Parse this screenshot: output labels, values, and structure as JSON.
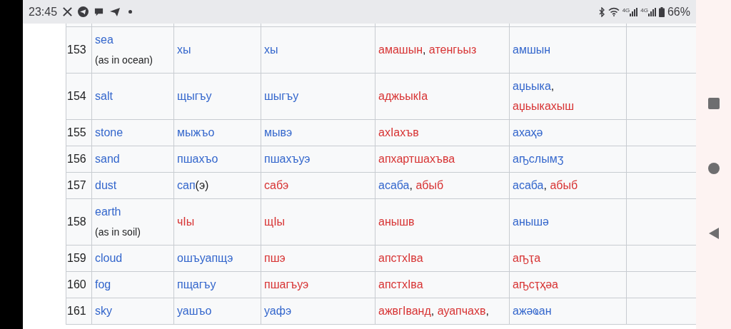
{
  "status_bar": {
    "time": "23:45",
    "network_labels": [
      "4G",
      "4G"
    ],
    "battery": "66%"
  },
  "table": {
    "rows": [
      {
        "number": "153",
        "cells": [
          [
            [
              {
                "kind": "link",
                "text": "sea"
              }
            ],
            [
              {
                "kind": "note",
                "text": "(as in ocean)"
              }
            ]
          ],
          [
            [
              {
                "kind": "link",
                "text": "хы"
              }
            ]
          ],
          [
            [
              {
                "kind": "link",
                "text": "хы"
              }
            ]
          ],
          [
            [
              {
                "kind": "redlink",
                "text": "амашын"
              },
              {
                "kind": "plain",
                "text": ", "
              },
              {
                "kind": "redlink",
                "text": "атенгьыз"
              }
            ]
          ],
          [
            [
              {
                "kind": "link",
                "text": "амшын"
              }
            ]
          ]
        ]
      },
      {
        "number": "154",
        "cells": [
          [
            [
              {
                "kind": "link",
                "text": "salt"
              }
            ]
          ],
          [
            [
              {
                "kind": "link",
                "text": "щыгъу"
              }
            ]
          ],
          [
            [
              {
                "kind": "link",
                "text": "шыгъу"
              }
            ]
          ],
          [
            [
              {
                "kind": "redlink",
                "text": "аджьыкIа"
              }
            ]
          ],
          [
            [
              {
                "kind": "link",
                "text": "аџьыка"
              },
              {
                "kind": "plain",
                "text": ","
              }
            ],
            [
              {
                "kind": "redlink",
                "text": "аџьыкахыш"
              }
            ]
          ]
        ]
      },
      {
        "number": "155",
        "cells": [
          [
            [
              {
                "kind": "link",
                "text": "stone"
              }
            ]
          ],
          [
            [
              {
                "kind": "link",
                "text": "мыжъо"
              }
            ]
          ],
          [
            [
              {
                "kind": "link",
                "text": "мывэ"
              }
            ]
          ],
          [
            [
              {
                "kind": "redlink",
                "text": "ахIахъв"
              }
            ]
          ],
          [
            [
              {
                "kind": "link",
                "text": "ахаҳә"
              }
            ]
          ]
        ]
      },
      {
        "number": "156",
        "cells": [
          [
            [
              {
                "kind": "link",
                "text": "sand"
              }
            ]
          ],
          [
            [
              {
                "kind": "link",
                "text": "пшахъо"
              }
            ]
          ],
          [
            [
              {
                "kind": "link",
                "text": "пшахъуэ"
              }
            ]
          ],
          [
            [
              {
                "kind": "redlink",
                "text": "апхартшахъва"
              }
            ]
          ],
          [
            [
              {
                "kind": "link",
                "text": "аҧслымӡ"
              }
            ]
          ]
        ]
      },
      {
        "number": "157",
        "cells": [
          [
            [
              {
                "kind": "link",
                "text": "dust"
              }
            ]
          ],
          [
            [
              {
                "kind": "link",
                "text": "сап"
              },
              {
                "kind": "plain",
                "text": "(э)"
              }
            ]
          ],
          [
            [
              {
                "kind": "redlink",
                "text": "сабэ"
              }
            ]
          ],
          [
            [
              {
                "kind": "link",
                "text": "асаба"
              },
              {
                "kind": "plain",
                "text": ", "
              },
              {
                "kind": "redlink",
                "text": "абыб"
              }
            ]
          ],
          [
            [
              {
                "kind": "link",
                "text": "асаба"
              },
              {
                "kind": "plain",
                "text": ", "
              },
              {
                "kind": "redlink",
                "text": "абыб"
              }
            ]
          ]
        ]
      },
      {
        "number": "158",
        "cells": [
          [
            [
              {
                "kind": "link",
                "text": "earth"
              }
            ],
            [
              {
                "kind": "note",
                "text": "(as in soil)"
              }
            ]
          ],
          [
            [
              {
                "kind": "redlink",
                "text": "чIы"
              }
            ]
          ],
          [
            [
              {
                "kind": "redlink",
                "text": "щIы"
              }
            ]
          ],
          [
            [
              {
                "kind": "redlink",
                "text": "анышв"
              }
            ]
          ],
          [
            [
              {
                "kind": "link",
                "text": "анышә"
              }
            ]
          ]
        ]
      },
      {
        "number": "159",
        "cells": [
          [
            [
              {
                "kind": "link",
                "text": "cloud"
              }
            ]
          ],
          [
            [
              {
                "kind": "link",
                "text": "ошъуапщэ"
              }
            ]
          ],
          [
            [
              {
                "kind": "redlink",
                "text": "пшэ"
              }
            ]
          ],
          [
            [
              {
                "kind": "redlink",
                "text": "апстхIва"
              }
            ]
          ],
          [
            [
              {
                "kind": "redlink",
                "text": "аҧҭа"
              }
            ]
          ]
        ]
      },
      {
        "number": "160",
        "cells": [
          [
            [
              {
                "kind": "link",
                "text": "fog"
              }
            ]
          ],
          [
            [
              {
                "kind": "link",
                "text": "пщагъу"
              }
            ]
          ],
          [
            [
              {
                "kind": "redlink",
                "text": "пшагъуэ"
              }
            ]
          ],
          [
            [
              {
                "kind": "redlink",
                "text": "апстхIва"
              }
            ]
          ],
          [
            [
              {
                "kind": "redlink",
                "text": "аҧсҭҳәа"
              }
            ]
          ]
        ]
      },
      {
        "number": "161",
        "cells": [
          [
            [
              {
                "kind": "link",
                "text": "sky"
              }
            ]
          ],
          [
            [
              {
                "kind": "link",
                "text": "уашъо"
              }
            ]
          ],
          [
            [
              {
                "kind": "link",
                "text": "уафэ"
              }
            ]
          ],
          [
            [
              {
                "kind": "redlink",
                "text": "ажвгIванд"
              },
              {
                "kind": "plain",
                "text": ", "
              },
              {
                "kind": "redlink",
                "text": "ауапчахв"
              },
              {
                "kind": "plain",
                "text": ","
              }
            ]
          ],
          [
            [
              {
                "kind": "link",
                "text": "ажәҩан"
              }
            ]
          ]
        ]
      }
    ]
  }
}
